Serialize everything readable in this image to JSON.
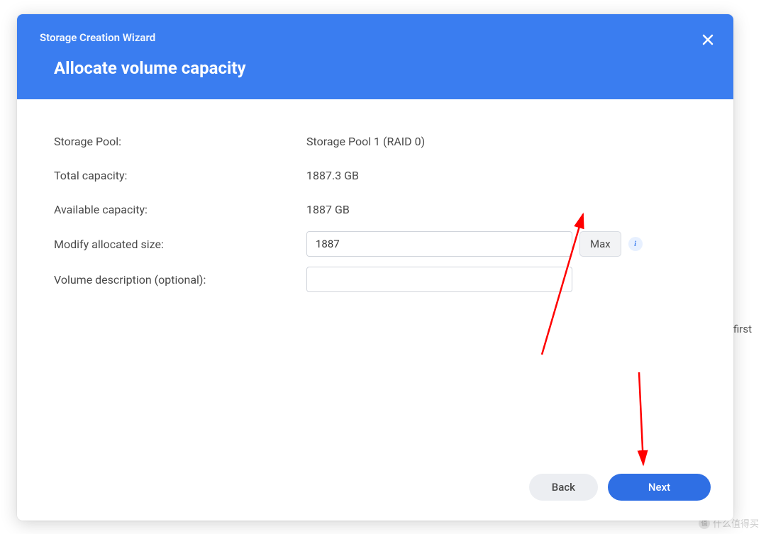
{
  "background": {
    "text": "first",
    "watermark": "什么值得买"
  },
  "header": {
    "wizard_title": "Storage Creation Wizard",
    "page_title": "Allocate volume capacity"
  },
  "form": {
    "storage_pool": {
      "label": "Storage Pool:",
      "value": "Storage Pool 1 (RAID 0)"
    },
    "total_capacity": {
      "label": "Total capacity:",
      "value": "1887.3 GB"
    },
    "available_capacity": {
      "label": "Available capacity:",
      "value": "1887 GB"
    },
    "allocated_size": {
      "label": "Modify allocated size:",
      "value": "1887",
      "max_button": "Max"
    },
    "description": {
      "label": "Volume description (optional):",
      "value": ""
    }
  },
  "footer": {
    "back": "Back",
    "next": "Next"
  }
}
